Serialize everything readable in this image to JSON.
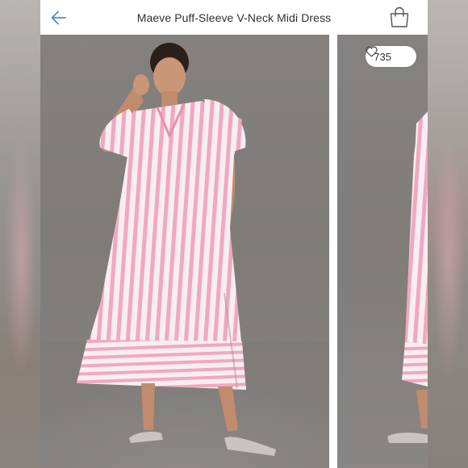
{
  "header": {
    "title": "Maeve Puff-Sleeve V-Neck Midi Dress",
    "back_icon": "arrow-left-icon",
    "bag_icon": "shopping-bag-icon"
  },
  "gallery": {
    "likes_count": "735",
    "like_icon": "heart-outline-icon",
    "images": [
      {
        "description": "model wearing pink striped puff-sleeve midi dress"
      },
      {
        "description": "next product photo partially visible"
      }
    ]
  },
  "colors": {
    "accent": "#4a90c8",
    "stripe_pink": "#f0a8c0",
    "stripe_white": "#f8eef2",
    "backdrop": "#807d7a"
  }
}
